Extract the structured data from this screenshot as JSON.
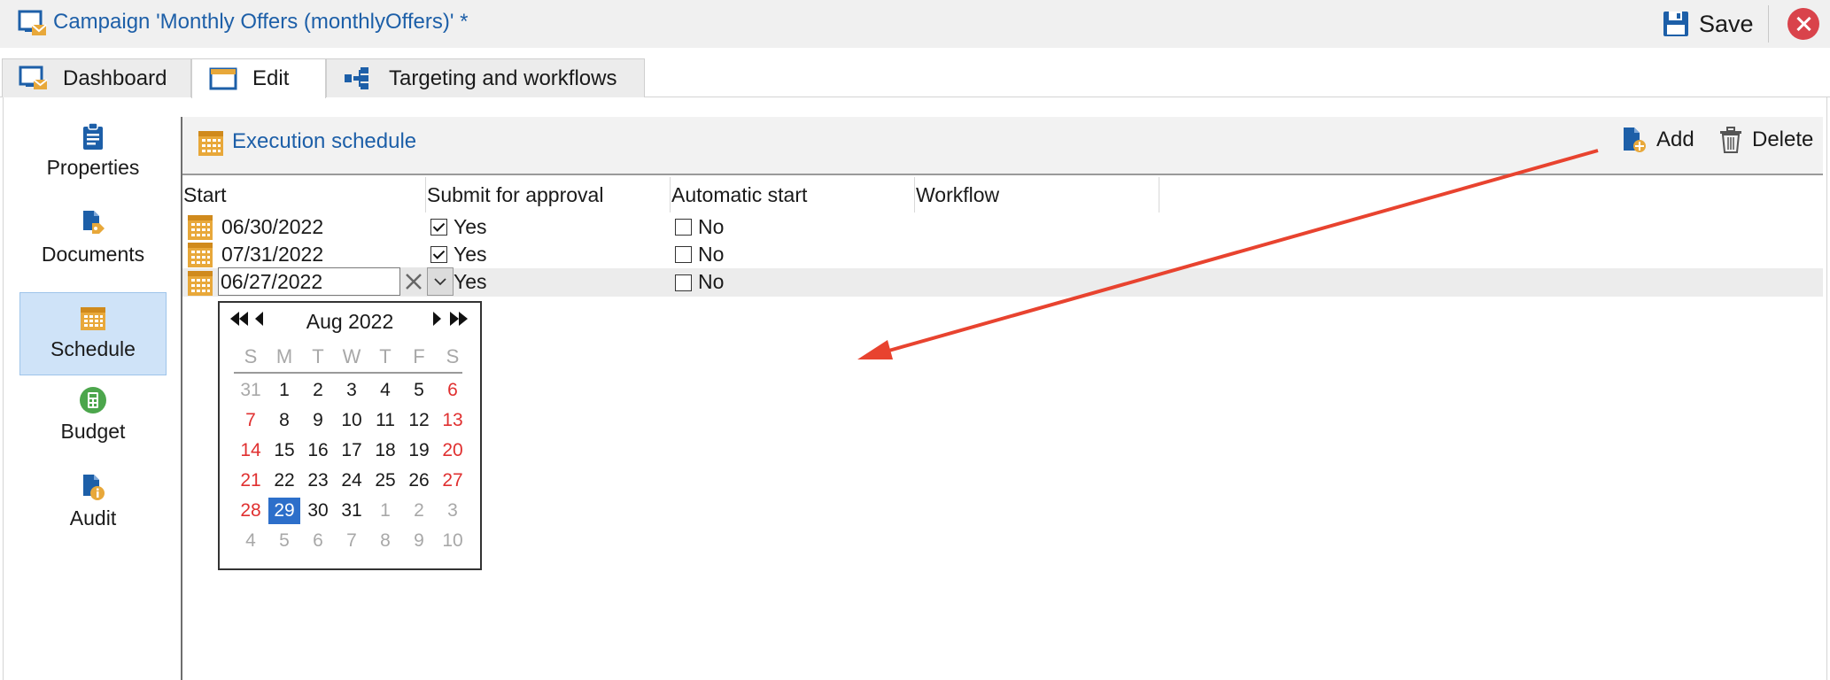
{
  "window": {
    "title": "Campaign 'Monthly Offers (monthlyOffers)' *",
    "save_label": "Save"
  },
  "tabs": [
    {
      "label": "Dashboard",
      "active": false
    },
    {
      "label": "Edit",
      "active": true
    },
    {
      "label": "Targeting and workflows",
      "active": false
    }
  ],
  "sidebar": {
    "items": [
      {
        "label": "Properties",
        "icon": "clipboard-icon",
        "active": false
      },
      {
        "label": "Documents",
        "icon": "documents-icon",
        "active": false
      },
      {
        "label": "Schedule",
        "icon": "calendar-icon",
        "active": true
      },
      {
        "label": "Budget",
        "icon": "calculator-icon",
        "active": false
      },
      {
        "label": "Audit",
        "icon": "audit-icon",
        "active": false
      }
    ]
  },
  "panel": {
    "title": "Execution schedule",
    "add_label": "Add",
    "delete_label": "Delete"
  },
  "grid": {
    "columns": [
      "Start",
      "Submit for approval",
      "Automatic start",
      "Workflow"
    ],
    "rows": [
      {
        "start": "06/30/2022",
        "approval_checked": true,
        "approval": "Yes",
        "auto_checked": false,
        "auto": "No"
      },
      {
        "start": "07/31/2022",
        "approval_checked": true,
        "approval": "Yes",
        "auto_checked": false,
        "auto": "No"
      },
      {
        "start": "06/27/2022",
        "approval_checked": true,
        "approval": "Yes",
        "auto_checked": false,
        "auto": "No",
        "editing": true
      }
    ]
  },
  "calendar": {
    "month_label": "Aug 2022",
    "weekdays": [
      "S",
      "M",
      "T",
      "W",
      "T",
      "F",
      "S"
    ],
    "weeks": [
      [
        "31",
        "1",
        "2",
        "3",
        "4",
        "5",
        "6"
      ],
      [
        "7",
        "8",
        "9",
        "10",
        "11",
        "12",
        "13"
      ],
      [
        "14",
        "15",
        "16",
        "17",
        "18",
        "19",
        "20"
      ],
      [
        "21",
        "22",
        "23",
        "24",
        "25",
        "26",
        "27"
      ],
      [
        "28",
        "29",
        "30",
        "31",
        "1",
        "2",
        "3"
      ],
      [
        "4",
        "5",
        "6",
        "7",
        "8",
        "9",
        "10"
      ]
    ],
    "selected_day": "29"
  },
  "colors": {
    "accent": "#1d5fa8",
    "selected_day": "#2d6fca",
    "weekend": "#e03030",
    "arrow": "#e8432f",
    "close": "#d9434b",
    "icon_gold": "#e8a83a"
  }
}
